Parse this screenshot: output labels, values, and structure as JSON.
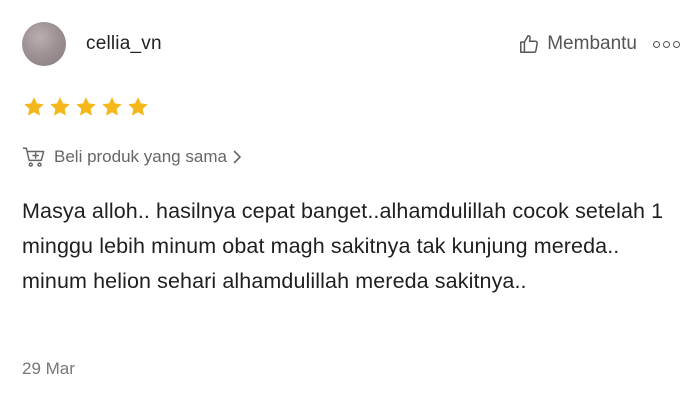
{
  "review": {
    "username": "cellia_vn",
    "helpful_label": "Membantu",
    "rating": 5,
    "rating_max": 5,
    "buy_same_label": "Beli produk yang sama",
    "text": "Masya alloh.. hasilnya cepat banget..alhamdulillah cocok setelah 1 minggu lebih minum obat magh sakitnya tak kunjung mereda.. minum helion sehari alhamdulillah mereda sakitnya..",
    "date": "29 Mar"
  },
  "icons": {
    "helpful": "thumbs-up-icon",
    "more": "more-options-icon",
    "star": "star-icon",
    "cart": "cart-add-icon",
    "chevron": "chevron-right-icon"
  },
  "colors": {
    "star": "#F5B81C",
    "text": "#1f1f1f",
    "muted": "#666666"
  }
}
